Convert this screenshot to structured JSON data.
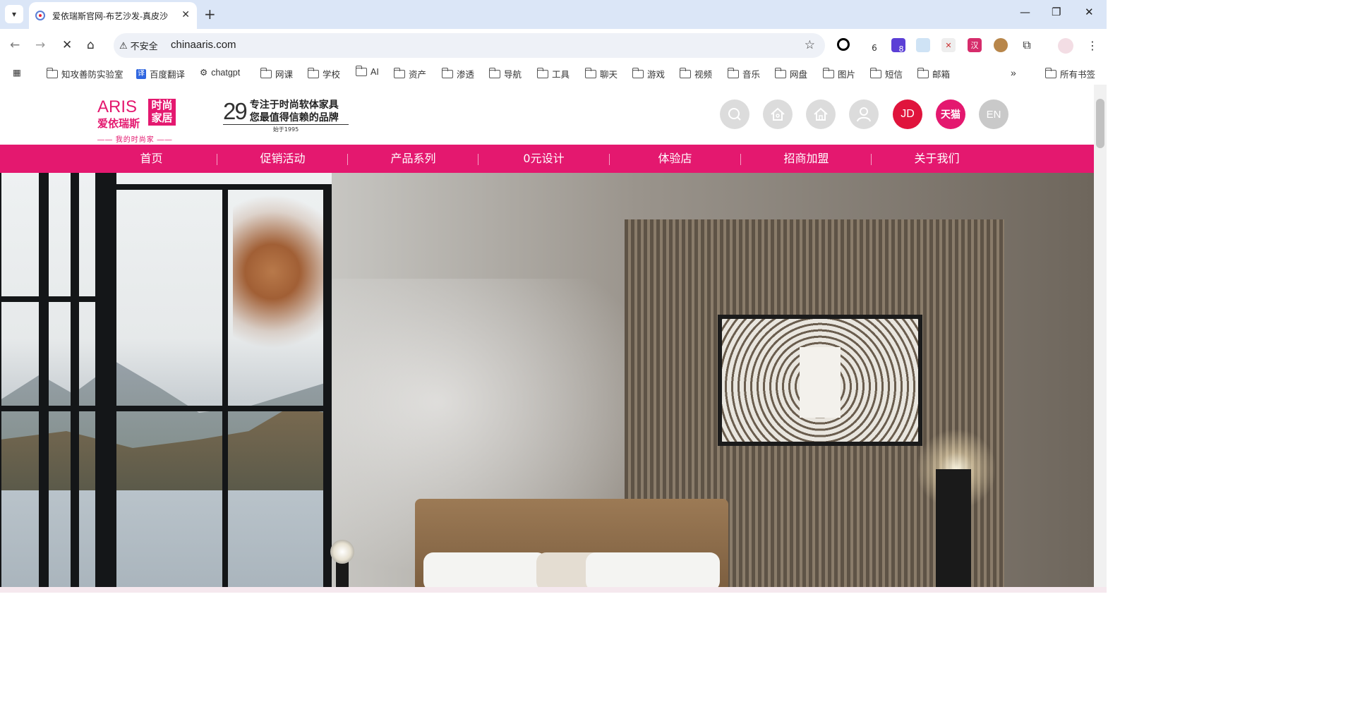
{
  "browser": {
    "tab_title": "爱依瑞斯官网-布艺沙发-真皮沙",
    "close_tab": "✕",
    "new_tab": "+",
    "url": "chinaaris.com",
    "security_label": "不安全",
    "bookmarks": [
      {
        "label": "知攻善防实验室",
        "icon": "folder-icon"
      },
      {
        "label": "百度翻译",
        "icon": "translate-icon"
      },
      {
        "label": "chatgpt",
        "icon": "openai-icon"
      },
      {
        "label": "网课",
        "icon": "folder-icon"
      },
      {
        "label": "学校",
        "icon": "folder-icon"
      },
      {
        "label": "AI",
        "icon": "folder-icon"
      },
      {
        "label": "资产",
        "icon": "folder-icon"
      },
      {
        "label": "渗透",
        "icon": "folder-icon"
      },
      {
        "label": "导航",
        "icon": "folder-icon"
      },
      {
        "label": "工具",
        "icon": "folder-icon"
      },
      {
        "label": "聊天",
        "icon": "folder-icon"
      },
      {
        "label": "游戏",
        "icon": "folder-icon"
      },
      {
        "label": "视频",
        "icon": "folder-icon"
      },
      {
        "label": "音乐",
        "icon": "folder-icon"
      },
      {
        "label": "网盘",
        "icon": "folder-icon"
      },
      {
        "label": "图片",
        "icon": "folder-icon"
      },
      {
        "label": "短信",
        "icon": "folder-icon"
      },
      {
        "label": "邮箱",
        "icon": "folder-icon"
      }
    ],
    "all_bookmarks": "所有书签",
    "extension_badges": {
      "ext1": "6",
      "ext2": "8"
    }
  },
  "site": {
    "logo": {
      "brand": "ARIS",
      "cn_name": "爱依瑞斯",
      "box_text": "时尚家居",
      "tagline": "—— 我的时尚家 ——"
    },
    "slogan": {
      "years": "29",
      "line1": "专注于时尚软体家具",
      "line2": "您最值得信赖的品牌",
      "since": "始于1995"
    },
    "header_icons": [
      {
        "name": "search-icon",
        "label": ""
      },
      {
        "name": "home-outline-icon",
        "label": ""
      },
      {
        "name": "house-icon",
        "label": ""
      },
      {
        "name": "user-icon",
        "label": ""
      },
      {
        "name": "jd-icon",
        "label": "JD"
      },
      {
        "name": "tmall-icon",
        "label": "天猫"
      },
      {
        "name": "language-icon",
        "label": "EN"
      }
    ],
    "nav": [
      "首页",
      "促销活动",
      "产品系列",
      "0元设计",
      "体验店",
      "招商加盟",
      "关于我们"
    ],
    "colors": {
      "brand": "#e4186f",
      "jd": "#e0143c"
    }
  }
}
